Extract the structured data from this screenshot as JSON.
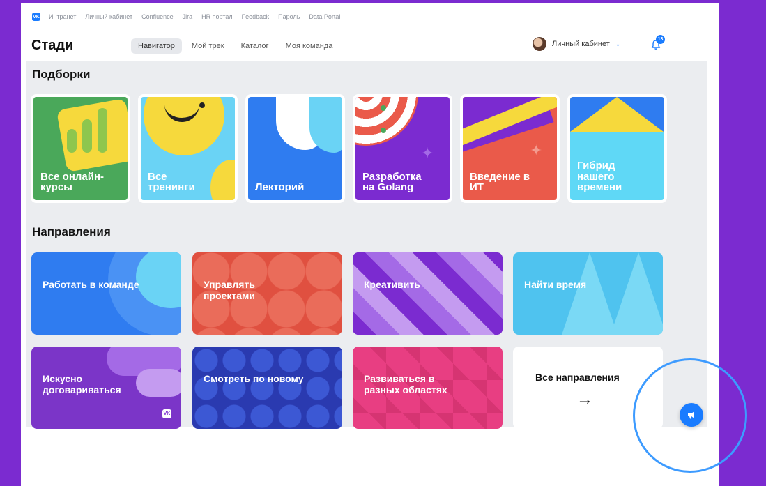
{
  "topnav": {
    "links": [
      "Интранет",
      "Личный кабинет",
      "Confluence",
      "Jira",
      "HR портал",
      "Feedback",
      "Пароль",
      "Data Portal"
    ]
  },
  "logo": "VK",
  "brand": "Стади",
  "tabs": [
    "Навигатор",
    "Мой трек",
    "Каталог",
    "Моя команда"
  ],
  "user": {
    "label": "Личный кабинет"
  },
  "notifications": {
    "count": "13"
  },
  "collections": {
    "title": "Подборки",
    "cards": [
      {
        "label": "Все онлайн-\nкурсы",
        "color": "#4aa85a"
      },
      {
        "label": "Все\nтренинги",
        "color": "#6ad3f5"
      },
      {
        "label": "Лекторий",
        "color": "#2f7cf0"
      },
      {
        "label": "Разработка\nна Golang",
        "color": "#7b2bd0"
      },
      {
        "label": "Введение в\nИТ",
        "color": "#ea5a4a"
      },
      {
        "label": "Гибрид\nнашего\nвремени",
        "color": "#5fd8f6"
      }
    ]
  },
  "directions": {
    "title": "Направления",
    "cards": [
      {
        "label": "Работать в команде",
        "color": "#2f7cf0"
      },
      {
        "label": "Управлять\nпроектами",
        "color": "#e05040"
      },
      {
        "label": "Креативить",
        "color": "#8a3ad8"
      },
      {
        "label": "Найти время",
        "color": "#4fc3ef"
      },
      {
        "label": "Искусно\nдоговариваться",
        "color": "#7b35c8"
      },
      {
        "label": "Смотреть по новому",
        "color": "#2a3ab0"
      },
      {
        "label": "Развиваться в\nразных областях",
        "color": "#e83e82"
      }
    ],
    "all_label": "Все направления",
    "all_arrow": "→"
  }
}
